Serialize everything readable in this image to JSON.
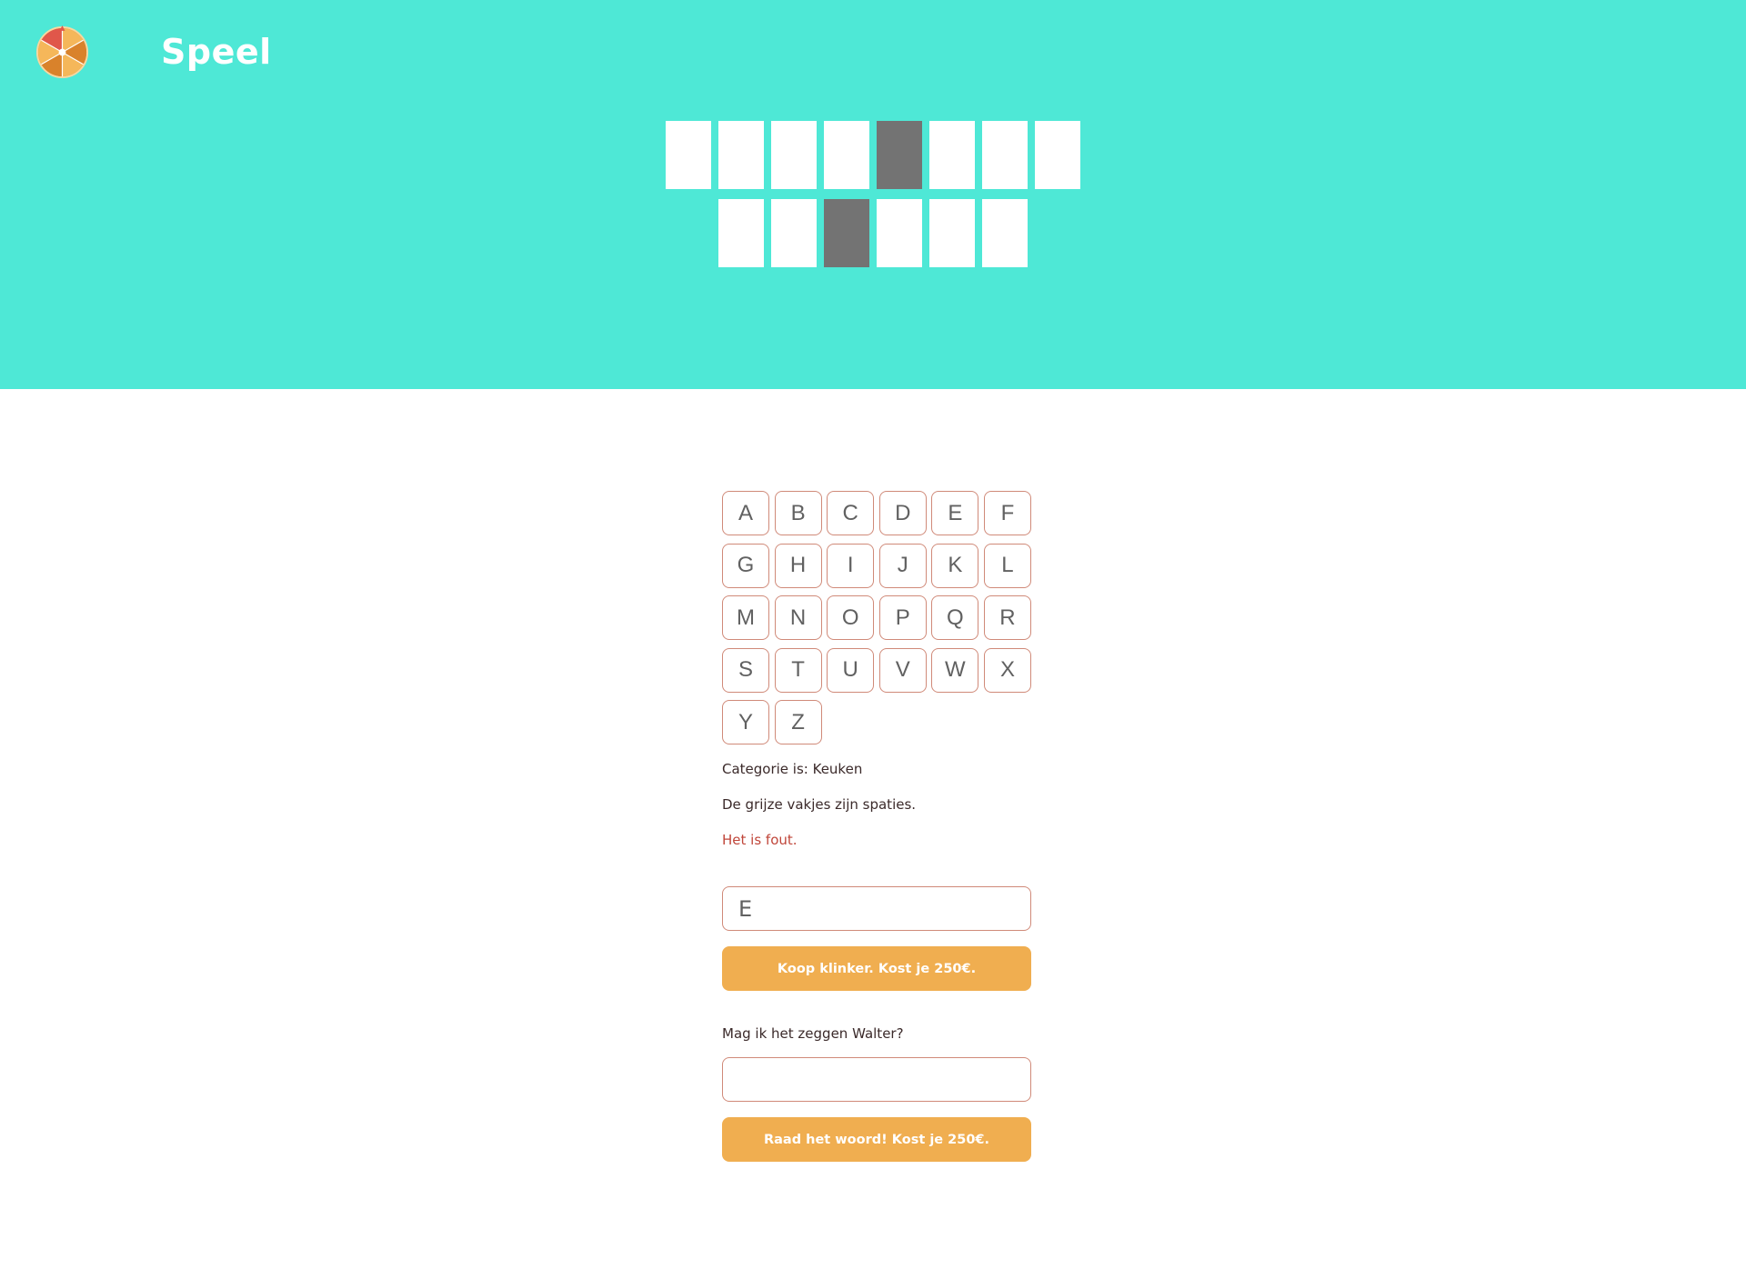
{
  "header": {
    "title": "Speel",
    "logo_icon": "wheel-of-fortune-icon"
  },
  "board": {
    "rows": [
      [
        "letter",
        "letter",
        "letter",
        "letter",
        "space",
        "letter",
        "letter",
        "letter"
      ],
      [
        "letter",
        "letter",
        "space",
        "letter",
        "letter",
        "letter"
      ]
    ]
  },
  "keyboard": {
    "letters": [
      "A",
      "B",
      "C",
      "D",
      "E",
      "F",
      "G",
      "H",
      "I",
      "J",
      "K",
      "L",
      "M",
      "N",
      "O",
      "P",
      "Q",
      "R",
      "S",
      "T",
      "U",
      "V",
      "W",
      "X",
      "Y",
      "Z"
    ]
  },
  "info": {
    "category": "Categorie is: Keuken",
    "spaces_hint": "De grijze vakjes zijn spaties.",
    "feedback": "Het is fout."
  },
  "vowel": {
    "input_value": "E",
    "button_label": "Koop klinker. Kost je 250€."
  },
  "guess": {
    "question": "Mag ik het zeggen Walter?",
    "input_value": "",
    "button_label": "Raad het woord! Kost je 250€."
  },
  "colors": {
    "hero_bg": "#4ee8d6",
    "space_tile": "#737373",
    "key_border": "#d08a79",
    "button_bg": "#f0ae50",
    "error_text": "#c0463a"
  }
}
